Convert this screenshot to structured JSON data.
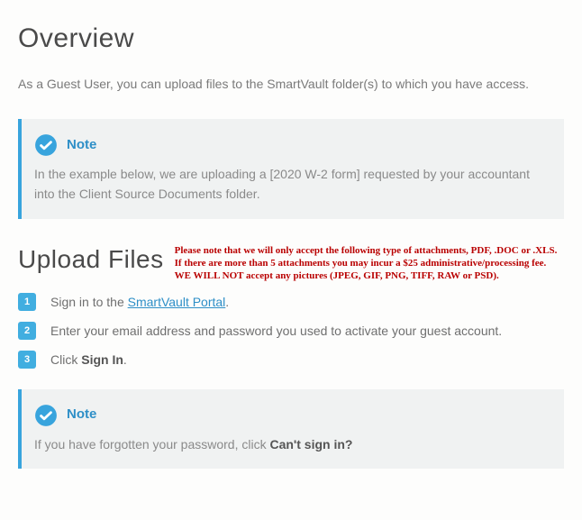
{
  "overview": {
    "heading": "Overview",
    "intro": "As a Guest User, you can upload files to the SmartVault folder(s) to which you have access."
  },
  "note1": {
    "label": "Note",
    "body": "In the example below, we are uploading a [2020 W-2 form] requested by your accountant into the Client Source Documents folder."
  },
  "upload": {
    "heading": "Upload Files",
    "warning": "Please note that we will only accept the following type of attachments, PDF, .DOC or .XLS. If there are more than 5 attachments you may incur a $25 administrative/processing fee. WE WILL NOT accept any pictures (JPEG, GIF, PNG, TIFF, RAW or PSD)."
  },
  "steps": [
    {
      "num": "1",
      "pre": "Sign in to the ",
      "link": "SmartVault Portal",
      "post": "."
    },
    {
      "num": "2",
      "pre": "Enter your email address and password you used to activate your guest account.",
      "link": "",
      "post": ""
    },
    {
      "num": "3",
      "pre": "Click ",
      "bold": "Sign In",
      "post": "."
    }
  ],
  "note2": {
    "label": "Note",
    "body_pre": "If you have forgotten your password, click ",
    "body_bold": "Can't sign in?"
  }
}
